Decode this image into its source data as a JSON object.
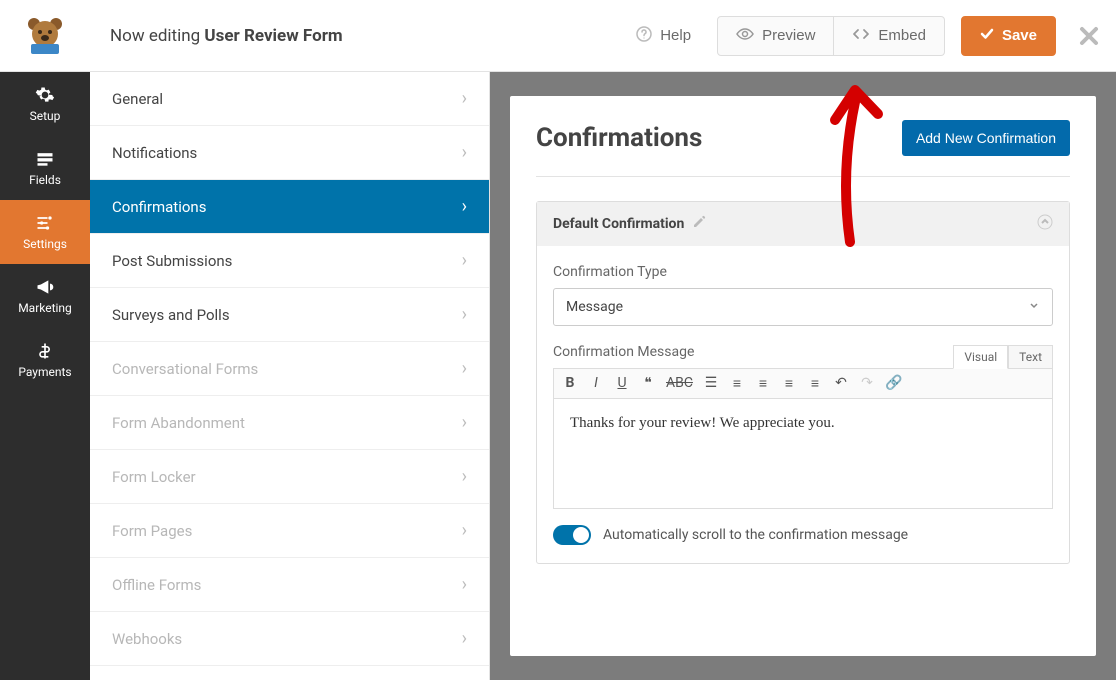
{
  "header": {
    "editing_prefix": "Now editing",
    "form_name": "User Review Form",
    "help": "Help",
    "preview": "Preview",
    "embed": "Embed",
    "save": "Save"
  },
  "rail": [
    {
      "label": "Setup"
    },
    {
      "label": "Fields"
    },
    {
      "label": "Settings"
    },
    {
      "label": "Marketing"
    },
    {
      "label": "Payments"
    }
  ],
  "side": [
    {
      "label": "General",
      "state": "normal"
    },
    {
      "label": "Notifications",
      "state": "normal"
    },
    {
      "label": "Confirmations",
      "state": "active"
    },
    {
      "label": "Post Submissions",
      "state": "normal"
    },
    {
      "label": "Surveys and Polls",
      "state": "normal"
    },
    {
      "label": "Conversational Forms",
      "state": "disabled"
    },
    {
      "label": "Form Abandonment",
      "state": "disabled"
    },
    {
      "label": "Form Locker",
      "state": "disabled"
    },
    {
      "label": "Form Pages",
      "state": "disabled"
    },
    {
      "label": "Offline Forms",
      "state": "disabled"
    },
    {
      "label": "Webhooks",
      "state": "disabled"
    }
  ],
  "panel": {
    "title": "Confirmations",
    "add_btn": "Add New Confirmation",
    "card_title": "Default Confirmation",
    "type_label": "Confirmation Type",
    "type_value": "Message",
    "msg_label": "Confirmation Message",
    "tab_visual": "Visual",
    "tab_text": "Text",
    "message": "Thanks for your review! We appreciate you.",
    "scroll_label": "Automatically scroll to the confirmation message"
  }
}
